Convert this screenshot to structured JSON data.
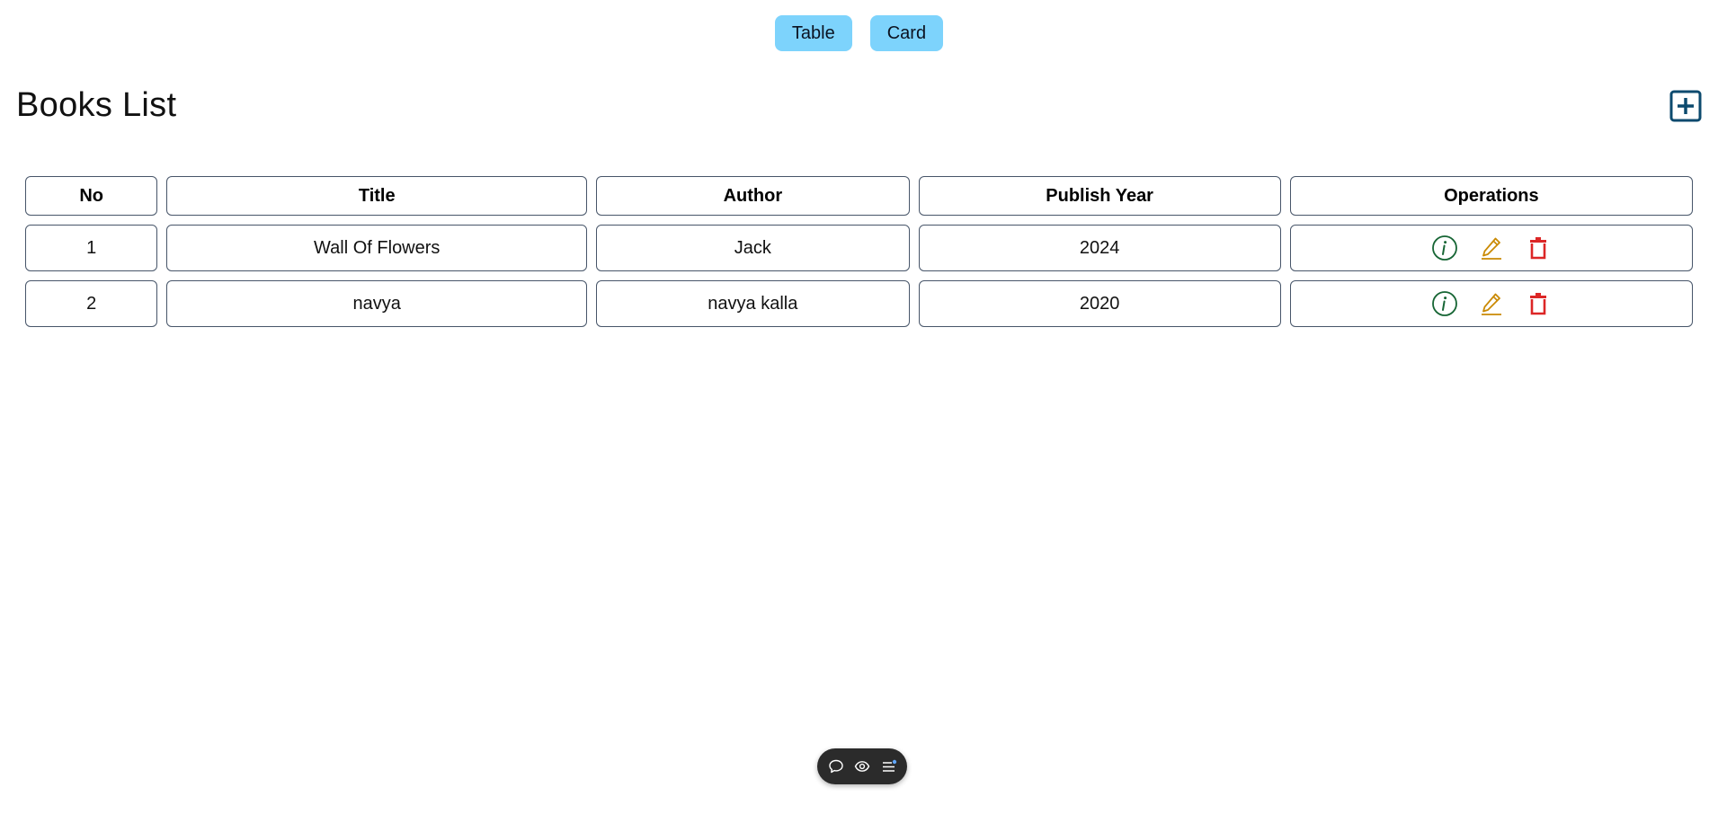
{
  "view_toggle": {
    "table_label": "Table",
    "card_label": "Card"
  },
  "header": {
    "title": "Books List",
    "add_icon": "plus-square-icon"
  },
  "table": {
    "columns": [
      "No",
      "Title",
      "Author",
      "Publish Year",
      "Operations"
    ],
    "rows": [
      {
        "no": "1",
        "title": "Wall Of Flowers",
        "author": "Jack",
        "year": "2024"
      },
      {
        "no": "2",
        "title": "navya",
        "author": "navya kalla",
        "year": "2020"
      }
    ],
    "operation_icons": [
      "info-circle-icon",
      "edit-pencil-icon",
      "trash-icon"
    ]
  },
  "colors": {
    "toggle_bg": "#7dd3fc",
    "add_icon": "#0c4a6e",
    "info_icon": "#166534",
    "edit_icon": "#ca8a04",
    "delete_icon": "#dc2626",
    "border": "#475569"
  },
  "floating_toolbar": {
    "icons": [
      "chat-bubble-icon",
      "eye-icon",
      "list-menu-icon"
    ]
  }
}
